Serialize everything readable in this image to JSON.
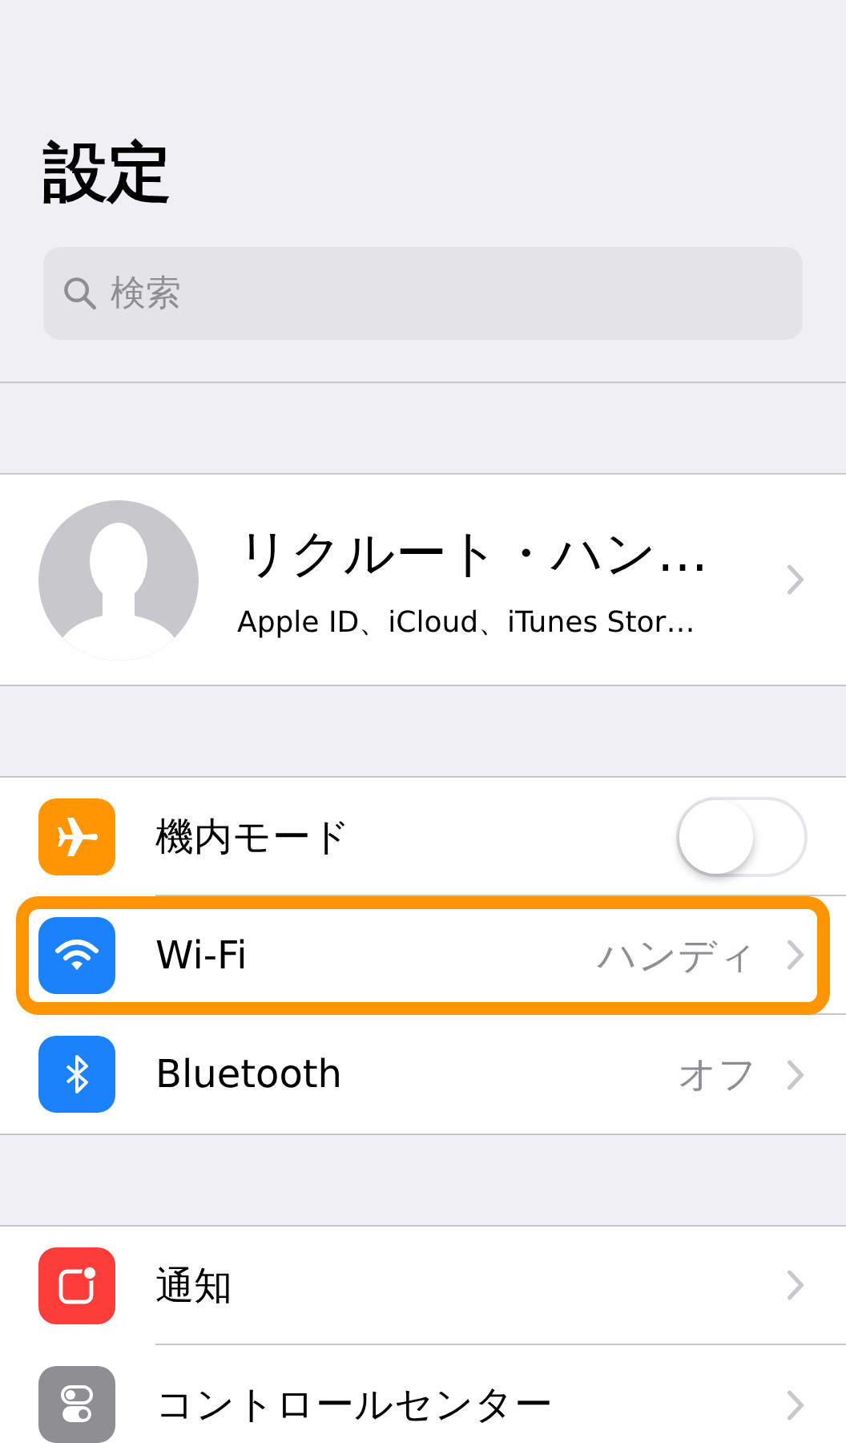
{
  "header": {
    "title": "設定"
  },
  "search": {
    "placeholder": "検索"
  },
  "profile": {
    "name": "リクルート・ハン…",
    "subtitle": "Apple ID、iCloud、iTunes Stor…"
  },
  "groups": [
    {
      "rows": [
        {
          "kind": "toggle",
          "label": "機内モード",
          "color": "#ff9500",
          "on": false,
          "highlighted": false
        },
        {
          "kind": "link",
          "label": "Wi-Fi",
          "value": "ハンディ",
          "color": "#1a82fb",
          "highlighted": true
        },
        {
          "kind": "link",
          "label": "Bluetooth",
          "value": "オフ",
          "color": "#1a82fb",
          "highlighted": false
        }
      ]
    },
    {
      "rows": [
        {
          "kind": "link",
          "label": "通知",
          "color": "#fc3d39",
          "highlighted": false
        },
        {
          "kind": "link",
          "label": "コントロールセンター",
          "color": "#8e8e93",
          "highlighted": false
        }
      ]
    }
  ]
}
